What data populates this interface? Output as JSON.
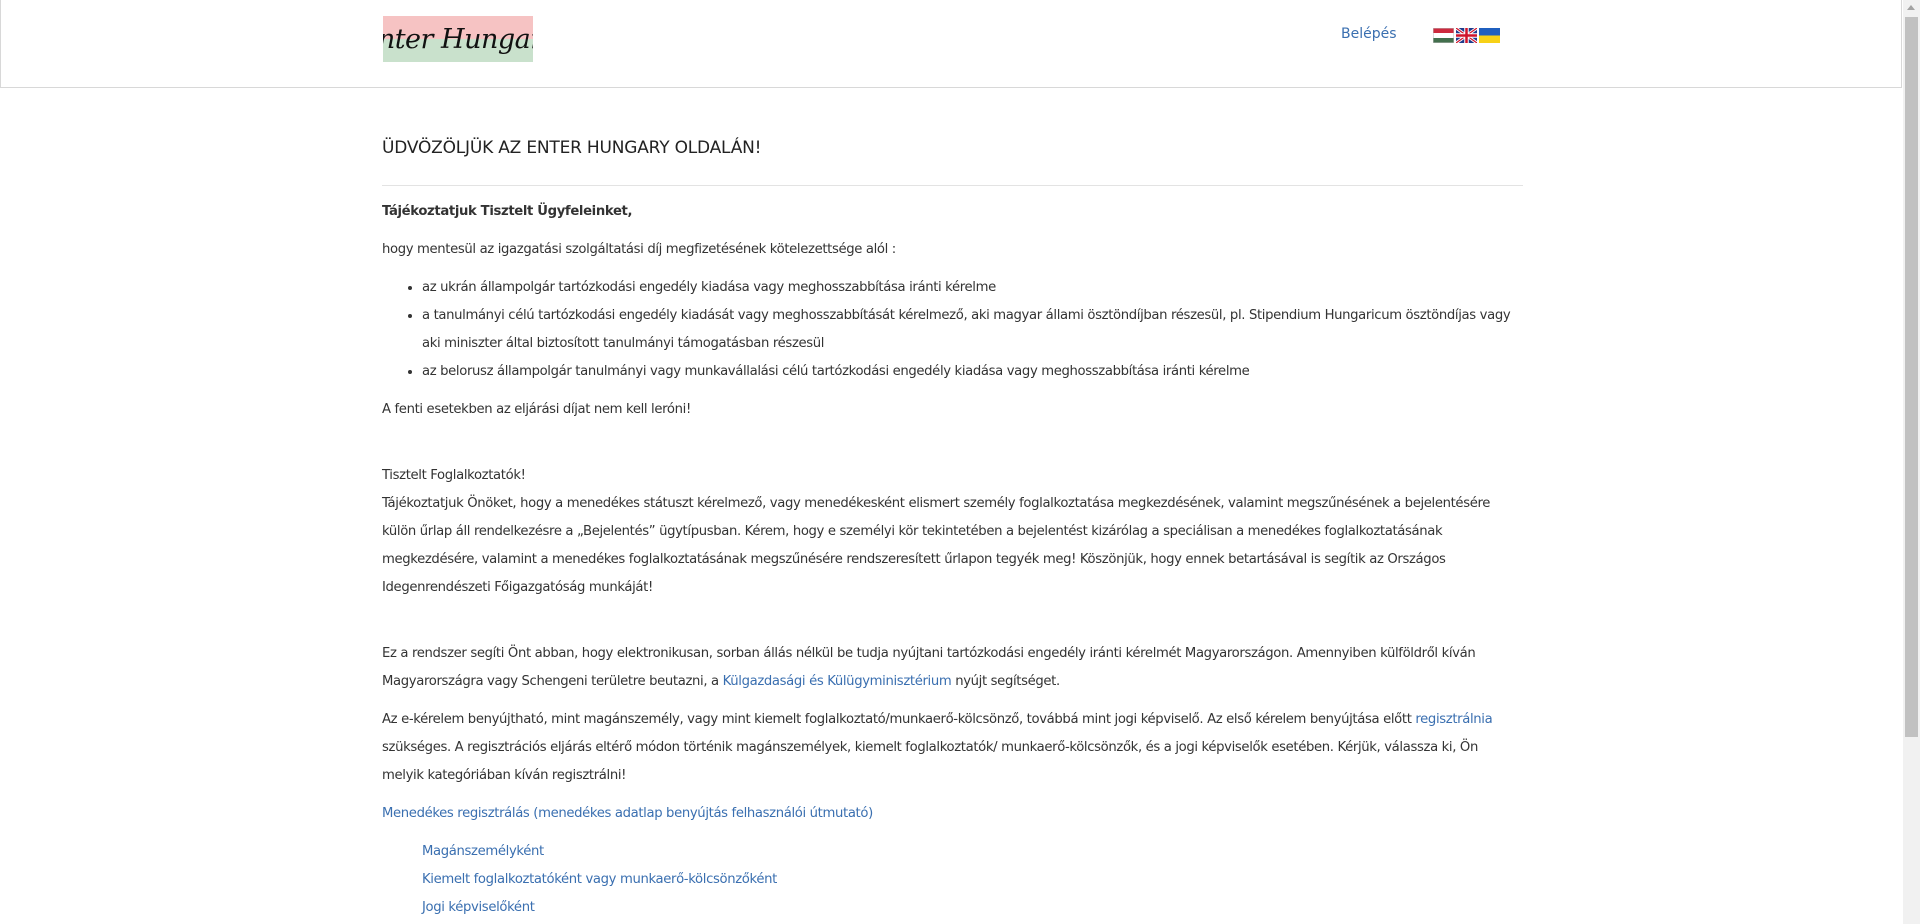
{
  "header": {
    "logo_text": "Enter Hungary",
    "login_label": "Belépés",
    "flags": [
      "hungarian-flag-icon",
      "british-flag-icon",
      "ukrainian-flag-icon"
    ]
  },
  "main": {
    "title": "ÜDVÖZÖLJÜK AZ ENTER HUNGARY OLDALÁN!",
    "greeting": "Tájékoztatjuk Tisztelt Ügyfeleinket,",
    "intro": "hogy mentesül az igazgatási szolgáltatási díj megfizetésének kötelezettsége alól :",
    "exemptions": [
      "az ukrán állampolgár tartózkodási engedély kiadása vagy meghosszabbítása iránti kérelme",
      "a tanulmányi célú tartózkodási engedély kiadását vagy meghosszabbítását kérelmező, aki magyar állami ösztöndíjban részesül, pl. Stipendium Hungaricum ösztöndíjas vagy aki miniszter által biztosított tanulmányi támogatásban részesül",
      "az belorusz állampolgár tanulmányi vagy munkavállalási célú tartózkodási engedély kiadása vagy meghosszabbítása iránti kérelme"
    ],
    "fee_note": "A fenti esetekben az eljárási díjat nem kell leróni!",
    "employers_heading": "Tisztelt Foglalkoztatók!",
    "employers_text": "Tájékoztatjuk Önöket, hogy a menedékes státuszt kérelmező, vagy menedékesként elismert személy foglalkoztatása megkezdésének, valamint megszűnésének a bejelentésére külön űrlap áll rendelkezésre a „Bejelentés” ügytípusban. Kérem, hogy e személyi kör tekintetében a bejelentést kizárólag a speciálisan a menedékes foglalkoztatásának megkezdésére, valamint a menedékes foglalkoztatásának megszűnésére rendszeresített űrlapon tegyék meg! Köszönjük, hogy ennek betartásával is segítik az Országos Idegenrendészeti Főigazgatóság munkáját!",
    "system_text_before": "Ez a rendszer segíti Önt abban, hogy elektronikusan, sorban állás nélkül be tudja nyújtani tartózkodási engedély iránti kérelmét Magyarországon. Amennyiben külföldről kíván Magyarországra vagy Schengeni területre beutazni, a ",
    "ministry_link": "Külgazdasági és Külügyminisztérium",
    "system_text_after": " nyújt segítséget.",
    "ekerelem_before": "Az e-kérelem benyújtható, mint magánszemély, vagy mint kiemelt foglalkoztató/munkaerő-kölcsönző, továbbá mint jogi képviselő. Az első kérelem benyújtása előtt ",
    "register_link": "regisztrálnia",
    "ekerelem_after": " szükséges. A regisztrációs eljárás eltérő módon történik magánszemélyek, kiemelt foglalkoztatók/ munkaerő-kölcsönzők, és a jogi képviselők esetében. Kérjük, válassza ki, Ön melyik kategóriában kíván regisztrálni!",
    "refugee_registration_link": "Menedékes regisztrálás (menedékes adatlap benyújtás felhasználói útmutató)",
    "registration_options": [
      "Magánszemélyként",
      "Kiemelt foglalkoztatóként vagy munkaerő-kölcsönzőként",
      "Jogi képviselőként"
    ]
  }
}
